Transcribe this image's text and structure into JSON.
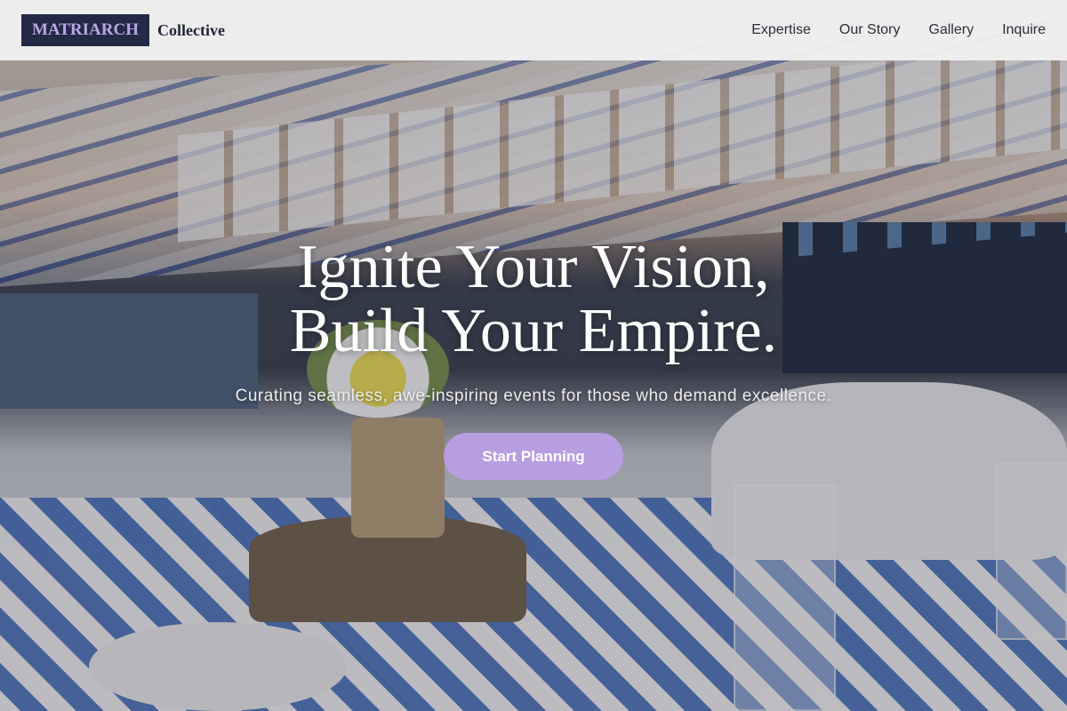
{
  "header": {
    "brand_mark": "MATRIARCH",
    "brand_name": "Collective",
    "nav": [
      {
        "label": "Expertise"
      },
      {
        "label": "Our Story"
      },
      {
        "label": "Gallery"
      },
      {
        "label": "Inquire"
      }
    ]
  },
  "hero": {
    "headline_line1": "Ignite Your Vision,",
    "headline_line2": "Build Your Empire.",
    "subheadline": "Curating seamless, awe-inspiring events for those who demand excellence.",
    "cta_label": "Start Planning"
  },
  "colors": {
    "brand_box": "#222a45",
    "brand_accent": "#b9a6e6",
    "cta": "#b79ee0",
    "header_bg": "#f0f0f0"
  }
}
